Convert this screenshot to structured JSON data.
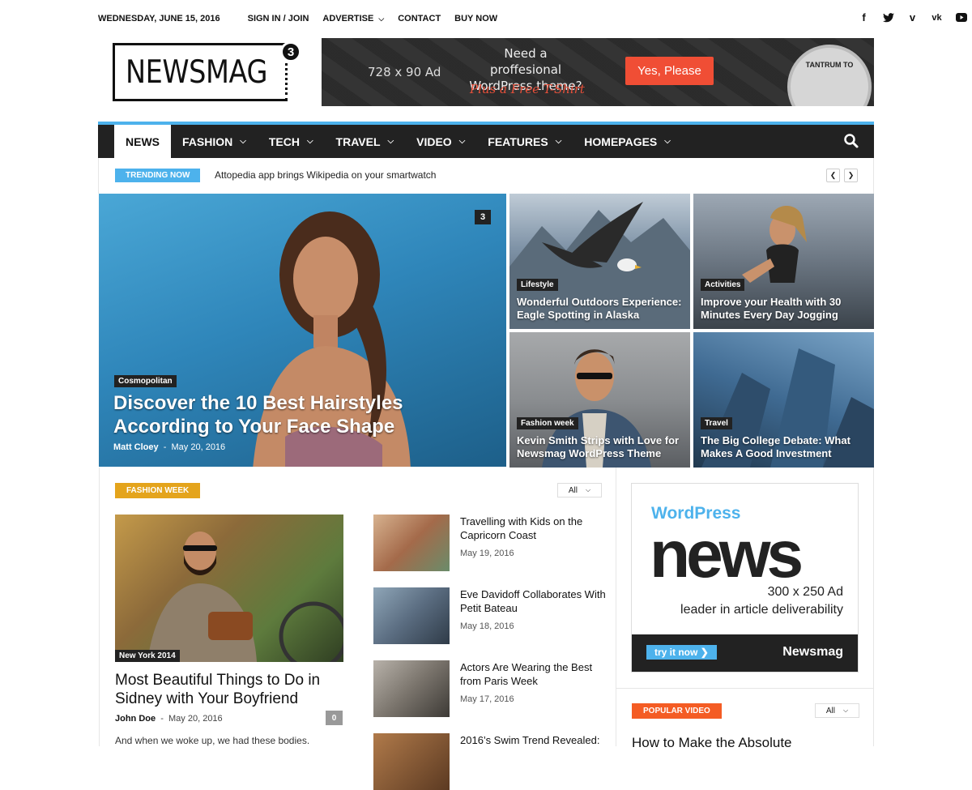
{
  "topbar": {
    "date": "WEDNESDAY, JUNE 15, 2016",
    "links": [
      "SIGN IN / JOIN",
      "ADVERTISE",
      "CONTACT",
      "BUY NOW"
    ],
    "social_icons": [
      "facebook-icon",
      "twitter-icon",
      "vimeo-icon",
      "vk-icon",
      "youtube-icon"
    ]
  },
  "logo": {
    "text": "NEWSMAG",
    "version": "3"
  },
  "header_ad": {
    "size": "728 x 90 Ad",
    "line1": "Need a proffesional",
    "line2": "WordPress theme?",
    "line3": "Plus a Free T-Shirt",
    "button": "Yes, Please",
    "shirt_text": "TANTRUM TO"
  },
  "nav": {
    "items": [
      {
        "label": "NEWS",
        "dropdown": false
      },
      {
        "label": "FASHION",
        "dropdown": true
      },
      {
        "label": "TECH",
        "dropdown": true
      },
      {
        "label": "TRAVEL",
        "dropdown": true
      },
      {
        "label": "VIDEO",
        "dropdown": true
      },
      {
        "label": "FEATURES",
        "dropdown": true
      },
      {
        "label": "HOMEPAGES",
        "dropdown": true
      }
    ],
    "accent": "#4db2ec"
  },
  "trending": {
    "label": "TRENDING NOW",
    "title": "Attopedia app brings Wikipedia on your smartwatch"
  },
  "mosaic": {
    "big": {
      "category": "Cosmopolitan",
      "title": "Discover the 10 Best Hairstyles According to Your Face Shape",
      "author": "Matt Cloey",
      "date": "May 20, 2016",
      "comments": "3"
    },
    "tiles": [
      {
        "category": "Lifestyle",
        "title": "Wonderful Outdoors Experience: Eagle Spotting in Alaska"
      },
      {
        "category": "Activities",
        "title": "Improve your Health with 30 Minutes Every Day Jogging"
      },
      {
        "category": "Fashion week",
        "title": "Kevin Smith Strips with Love for Newsmag WordPress Theme"
      },
      {
        "category": "Travel",
        "title": "The Big College Debate: What Makes A Good Investment"
      }
    ]
  },
  "fashion_week": {
    "heading": "FASHION WEEK",
    "filter": "All",
    "featured": {
      "category": "New York 2014",
      "title": "Most Beautiful Things to Do in Sidney with Your Boyfriend",
      "author": "John Doe",
      "date": "May 20, 2016",
      "comments": "0",
      "excerpt": "And when we woke up, we had these bodies."
    },
    "list": [
      {
        "title": "Travelling with Kids on the Capricorn Coast",
        "date": "May 19, 2016"
      },
      {
        "title": "Eve Davidoff Collaborates With Petit Bateau",
        "date": "May 18, 2016"
      },
      {
        "title": "Actors Are Wearing the Best from Paris Week",
        "date": "May 17, 2016"
      },
      {
        "title": "2016’s Swim Trend Revealed:",
        "date": ""
      }
    ]
  },
  "sidebar_ad": {
    "brand": "WordPress",
    "big": "news",
    "size": "300 x 250 Ad",
    "tagline": "leader in article deliverability",
    "button": "try it now",
    "name": "Newsmag"
  },
  "popular_video": {
    "heading": "POPULAR VIDEO",
    "filter": "All",
    "first_title": "How to Make the Absolute"
  }
}
